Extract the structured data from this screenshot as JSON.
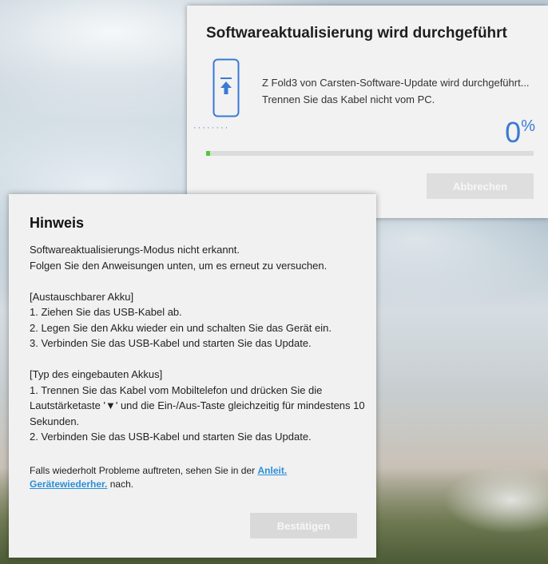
{
  "update_window": {
    "title": "Softwareaktualisierung wird durchgeführt",
    "message_line1": "Z Fold3 von Carsten-Software-Update wird durchgeführt...",
    "message_line2": "Trennen Sie das Kabel nicht vom PC.",
    "progress_value": "0",
    "progress_unit": "%",
    "progress_fraction": 0.005,
    "cancel_label": "Abbrechen"
  },
  "hint_dialog": {
    "title": "Hinweis",
    "intro_line1": "Softwareaktualisierungs-Modus nicht erkannt.",
    "intro_line2": "Folgen Sie den Anweisungen unten, um es erneut zu versuchen.",
    "section1_header": "[Austauschbarer Akku]",
    "section1_step1": "1. Ziehen Sie das USB-Kabel ab.",
    "section1_step2": "2. Legen Sie den Akku wieder ein und schalten Sie das Gerät ein.",
    "section1_step3": "3. Verbinden Sie das USB-Kabel und starten Sie das Update.",
    "section2_header": "[Typ des eingebauten Akkus]",
    "section2_step1": "1. Trennen Sie das Kabel vom Mobiltelefon und drücken Sie die Lautstärketaste '▼' und die Ein-/Aus-Taste gleichzeitig für mindestens 10 Sekunden.",
    "section2_step2": "2. Verbinden Sie das USB-Kabel und starten Sie das Update.",
    "footer_prefix": "Falls wiederholt Probleme auftreten, sehen Sie in der ",
    "footer_link": "Anleit. Gerätewiederher.",
    "footer_suffix": " nach.",
    "confirm_label": "Bestätigen"
  },
  "colors": {
    "accent_blue": "#3a7ad6",
    "link_blue": "#2a8fd9",
    "progress_green": "#52c93a",
    "disabled_button": "#d9d9d9"
  }
}
